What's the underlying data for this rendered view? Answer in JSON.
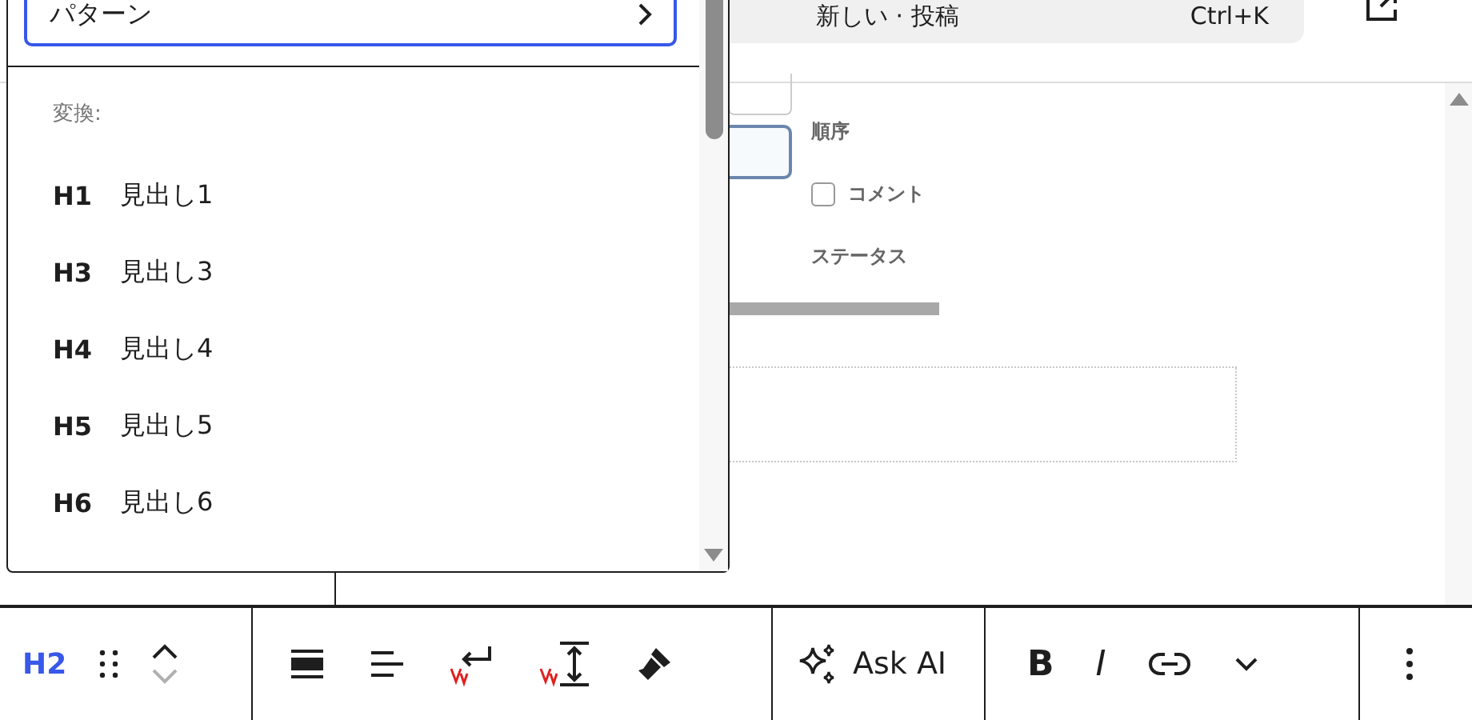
{
  "command_bar": {
    "title": "新しい · 投稿",
    "shortcut": "Ctrl+K"
  },
  "dropdown": {
    "top_item": {
      "label": "パターン",
      "selected": true
    },
    "section_label": "変換:",
    "items": [
      {
        "badge": "H1",
        "label": "見出し1",
        "selected": false
      },
      {
        "badge": "H3",
        "label": "見出し3",
        "selected": false
      },
      {
        "badge": "H4",
        "label": "見出し4",
        "selected": false
      },
      {
        "badge": "H5",
        "label": "見出し5",
        "selected": false
      },
      {
        "badge": "H6",
        "label": "見出し6",
        "selected": false
      }
    ]
  },
  "background_form": {
    "order_label": "順序",
    "comment_checkbox": {
      "label": "コメント",
      "checked": false
    },
    "status_label": "ステータス"
  },
  "toolbar": {
    "block_label": "H2",
    "move_up_disabled": false,
    "move_down_disabled": true,
    "ask_ai": "Ask AI",
    "bold": "B",
    "italic": "I"
  }
}
